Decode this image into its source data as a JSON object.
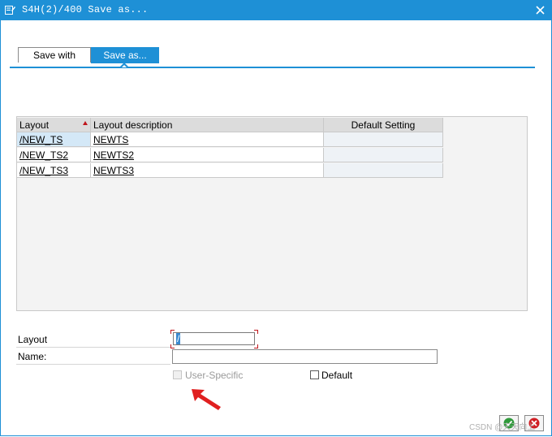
{
  "window": {
    "title": "S4H(2)/400 Save as...",
    "icon": "form-icon",
    "close_icon": "close-icon",
    "accent_color": "#1e90d6"
  },
  "tabs": [
    {
      "label": "Save with",
      "active": false
    },
    {
      "label": "Save as...",
      "active": true
    }
  ],
  "table": {
    "columns": [
      "Layout",
      "Layout description",
      "Default Setting"
    ],
    "sort_icon": "sort-descending-icon",
    "rows": [
      {
        "layout": "/NEW_TS",
        "description": "NEWTS",
        "default": ""
      },
      {
        "layout": "/NEW_TS2",
        "description": "NEWTS2",
        "default": ""
      },
      {
        "layout": "/NEW_TS3",
        "description": "NEWTS3",
        "default": ""
      }
    ]
  },
  "form": {
    "layout_label": "Layout",
    "layout_value": "/",
    "name_label": "Name:",
    "name_value": "",
    "user_specific_label": "User-Specific",
    "user_specific_checked": false,
    "user_specific_enabled": false,
    "default_label": "Default",
    "default_checked": false
  },
  "buttons": {
    "ok_icon": "checkmark-icon",
    "cancel_icon": "cancel-icon"
  },
  "annotation": {
    "arrow_icon": "red-arrow-icon",
    "arrow_color": "#e02020"
  },
  "watermark": "CSDN @天天向上"
}
